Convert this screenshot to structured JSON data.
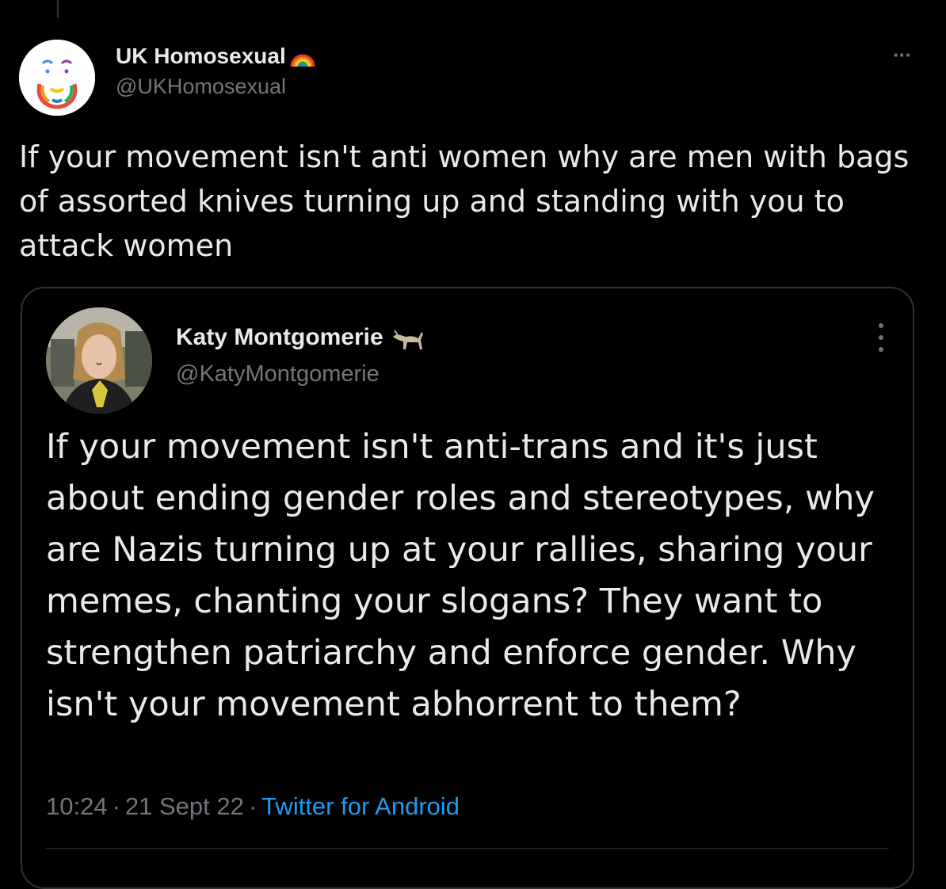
{
  "tweet": {
    "author": {
      "display_name": "UK Homosexual",
      "name_emoji": "rainbow-icon",
      "handle": "@UKHomosexual"
    },
    "more_label": "···",
    "text": "If your movement isn't anti women why are men with bags of assorted knives turning up and standing with you to attack women"
  },
  "quoted_tweet": {
    "author": {
      "display_name": "Katy Montgomerie",
      "name_emoji": "goat-icon",
      "handle": "@KatyMontgomerie"
    },
    "text": "If your movement isn't anti-trans and it's just about ending gender roles and stereotypes, why are Nazis turning up at your rallies, sharing your memes, chanting your slogans? They want to strengthen patriarchy and enforce gender. Why isn't your movement abhorrent to them?",
    "meta": {
      "time": "10:24",
      "date": "21 Sept 22",
      "separator": "·",
      "source": "Twitter for Android"
    }
  },
  "colors": {
    "background": "#000000",
    "primary_text": "#e7e9ea",
    "secondary_text": "#71767b",
    "link": "#1d9bf0",
    "border": "#2f3336"
  }
}
